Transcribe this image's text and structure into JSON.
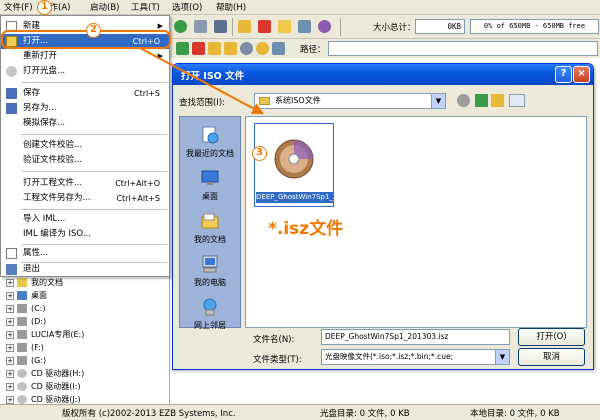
{
  "menubar": {
    "items": [
      "文件(F)",
      "操作(A)",
      "启动(B)",
      "工具(T)",
      "选项(O)",
      "帮助(H)"
    ]
  },
  "toolbar": {
    "total_label": "大小总计：",
    "total_value": "0KB",
    "capacity_text": "0% of 650MB - 650MB free"
  },
  "pathrow": {
    "label": "路径："
  },
  "file_menu": {
    "items": [
      {
        "label": "新建",
        "shortcut": "",
        "submenu": true
      },
      {
        "label": "打开...",
        "shortcut": "Ctrl+O",
        "submenu": false
      },
      {
        "label": "重新打开",
        "shortcut": "",
        "submenu": true
      },
      {
        "label": "打开光盘...",
        "shortcut": "",
        "submenu": false
      },
      {
        "label": "保存",
        "shortcut": "Ctrl+S",
        "submenu": false
      },
      {
        "label": "另存为...",
        "shortcut": "",
        "submenu": false
      },
      {
        "label": "模拟保存...",
        "shortcut": "",
        "submenu": false
      },
      {
        "label": "创建文件校验...",
        "shortcut": "",
        "submenu": false
      },
      {
        "label": "验证文件校验...",
        "shortcut": "",
        "submenu": false
      },
      {
        "label": "打开工程文件...",
        "shortcut": "Ctrl+Alt+O",
        "submenu": false
      },
      {
        "label": "工程文件另存为...",
        "shortcut": "Ctrl+Alt+S",
        "submenu": false
      },
      {
        "label": "导入 IML...",
        "shortcut": "",
        "submenu": false
      },
      {
        "label": "IML 编译为 ISO...",
        "shortcut": "",
        "submenu": false
      },
      {
        "label": "属性...",
        "shortcut": "",
        "submenu": false
      },
      {
        "label": "退出",
        "shortcut": "",
        "submenu": false
      }
    ]
  },
  "tree": {
    "items": [
      "我的文档",
      "桌面",
      "(C:)",
      "(D:)",
      "LUCIA专用(E:)",
      "(F:)",
      "(G:)",
      "CD 驱动器(H:)",
      "CD 驱动器(I:)",
      "CD 驱动器(J:)"
    ]
  },
  "dialog": {
    "title": "打开 ISO 文件",
    "help_button": "?",
    "close_button": "×",
    "lookin_label": "查找范围(I):",
    "lookin_value": "系统ISO文件",
    "places": [
      "我最近的文档",
      "桌面",
      "我的文档",
      "我的电脑",
      "网上邻居"
    ],
    "file_name": "DEEP_GhostWin7Sp1_201303.isz",
    "filename_label": "文件名(N):",
    "filename_value": "DEEP_GhostWin7Sp1_201303.isz",
    "filetype_label": "文件类型(T):",
    "filetype_value": "光盘映像文件(*.iso;*.isz;*.bin;*.cue;",
    "open_button": "打开(O)",
    "cancel_button": "取消"
  },
  "annotations": {
    "badge1": "1",
    "badge2": "2",
    "badge3": "3",
    "isz_label": "*.isz文件",
    "color": "#f07800"
  },
  "statusbar": {
    "copyright": "版权所有 (c)2002-2013 EZB Systems, Inc.",
    "disc_dir": "光盘目录: 0 文件, 0 KB",
    "local_dir": "本地目录: 0 文件, 0 KB"
  }
}
